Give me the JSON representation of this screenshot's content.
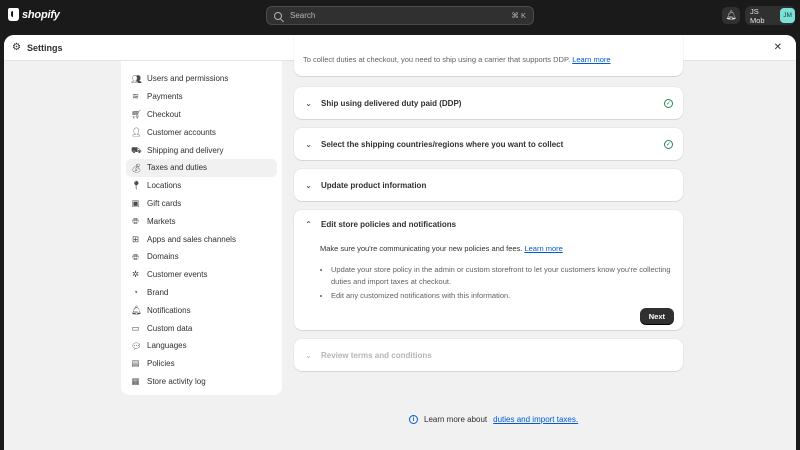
{
  "topbar": {
    "brand": "shopify",
    "search_placeholder": "Search",
    "search_shortcut": "⌘ K",
    "store_name": "JS Mob",
    "avatar_initials": "JM"
  },
  "window": {
    "title": "Settings"
  },
  "sidebar": {
    "active": "Taxes and duties",
    "items": [
      {
        "label": "Users and permissions",
        "icon": "users-icon"
      },
      {
        "label": "Payments",
        "icon": "payments-icon"
      },
      {
        "label": "Checkout",
        "icon": "cart-icon"
      },
      {
        "label": "Customer accounts",
        "icon": "person-icon"
      },
      {
        "label": "Shipping and delivery",
        "icon": "truck-icon"
      },
      {
        "label": "Taxes and duties",
        "icon": "money-bag-icon"
      },
      {
        "label": "Locations",
        "icon": "location-icon"
      },
      {
        "label": "Gift cards",
        "icon": "gift-card-icon"
      },
      {
        "label": "Markets",
        "icon": "globe-icon"
      },
      {
        "label": "Apps and sales channels",
        "icon": "apps-icon"
      },
      {
        "label": "Domains",
        "icon": "domain-icon"
      },
      {
        "label": "Customer events",
        "icon": "events-icon"
      },
      {
        "label": "Brand",
        "icon": "brand-icon"
      },
      {
        "label": "Notifications",
        "icon": "bell-icon"
      },
      {
        "label": "Custom data",
        "icon": "database-icon"
      },
      {
        "label": "Languages",
        "icon": "languages-icon"
      },
      {
        "label": "Policies",
        "icon": "policies-icon"
      },
      {
        "label": "Store activity log",
        "icon": "activity-log-icon"
      }
    ]
  },
  "main": {
    "top_partial_text": "To collect duties at checkout, you need to ship using a carrier that supports DDP.",
    "top_partial_link": "Learn more",
    "steps": [
      {
        "title": "Ship using delivered duty paid (DDP)",
        "completed": true
      },
      {
        "title": "Select the shipping countries/regions where you want to collect",
        "completed": true
      },
      {
        "title": "Update product information",
        "completed": false
      },
      {
        "title": "Edit store policies and notifications",
        "completed": false,
        "expanded": true
      },
      {
        "title": "Review terms and conditions",
        "completed": false,
        "disabled": true
      }
    ],
    "expanded": {
      "description": "Make sure you're communicating your new policies and fees.",
      "description_link": "Learn more",
      "bullets": [
        "Update your store policy in the admin or custom storefront to let your customers know you're collecting duties and import taxes at checkout.",
        "Edit any customized notifications with this information."
      ],
      "next_label": "Next"
    },
    "footer_text": "Learn more about",
    "footer_link": "duties and import taxes."
  }
}
